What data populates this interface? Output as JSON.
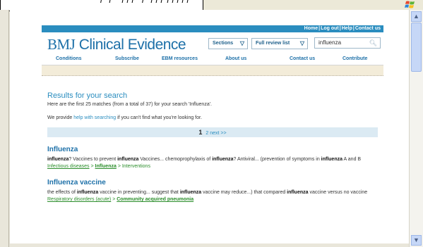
{
  "browser": {
    "callout_text": "  /  /   / / /  /  / / / / / / / /",
    "scroll_up": "▲",
    "scroll_down": "▼"
  },
  "site": {
    "util_links": [
      "Home",
      "Log out",
      "Help",
      "Contact us"
    ],
    "logo_bmj": "BMJ",
    "logo_rest": "Clinical Evidence",
    "sections_label": "Sections",
    "full_review_label": "Full review list",
    "dropdown_arrow": "▽",
    "search_value": "influenza",
    "nav": [
      "Conditions",
      "Subscribe",
      "EBM resources",
      "About us",
      "Contact us",
      "Contribute"
    ]
  },
  "results": {
    "heading": "Results for your search",
    "summary": "Here are the first 25 matches (from a total of 37) for your search 'Influenza'.",
    "help_pre": "We provide ",
    "help_link": "help with searching",
    "help_post": " if you can't find what you're looking for.",
    "pager_current": "1",
    "pager_page2": "2",
    "pager_next": "next >>",
    "items": [
      {
        "title": "Influenza",
        "snippet_html": "<b>influenza</b>? Vaccines to prevent <b>influenza</b> Vaccines... chemoprophylaxis of <b>influenza</b>? Antiviral... (prevention of symptoms in <b>influenza</b> A and B",
        "crumb1": "Infectious diseases",
        "crumb2": "Influenza",
        "crumb3": "Interventions",
        "crumb_sep": " > "
      },
      {
        "title": "Influenza vaccine",
        "snippet_html": "the effects of <b>influenza</b> vaccine in preventing... suggest that <b>influenza</b> vaccine may reduce...) that compared <b>influenza</b> vaccine versus no vaccine",
        "crumb1": "Respiratory disorders (acute)",
        "crumb2": "Community acquired pneumonia",
        "crumb_sep": " > "
      }
    ]
  }
}
